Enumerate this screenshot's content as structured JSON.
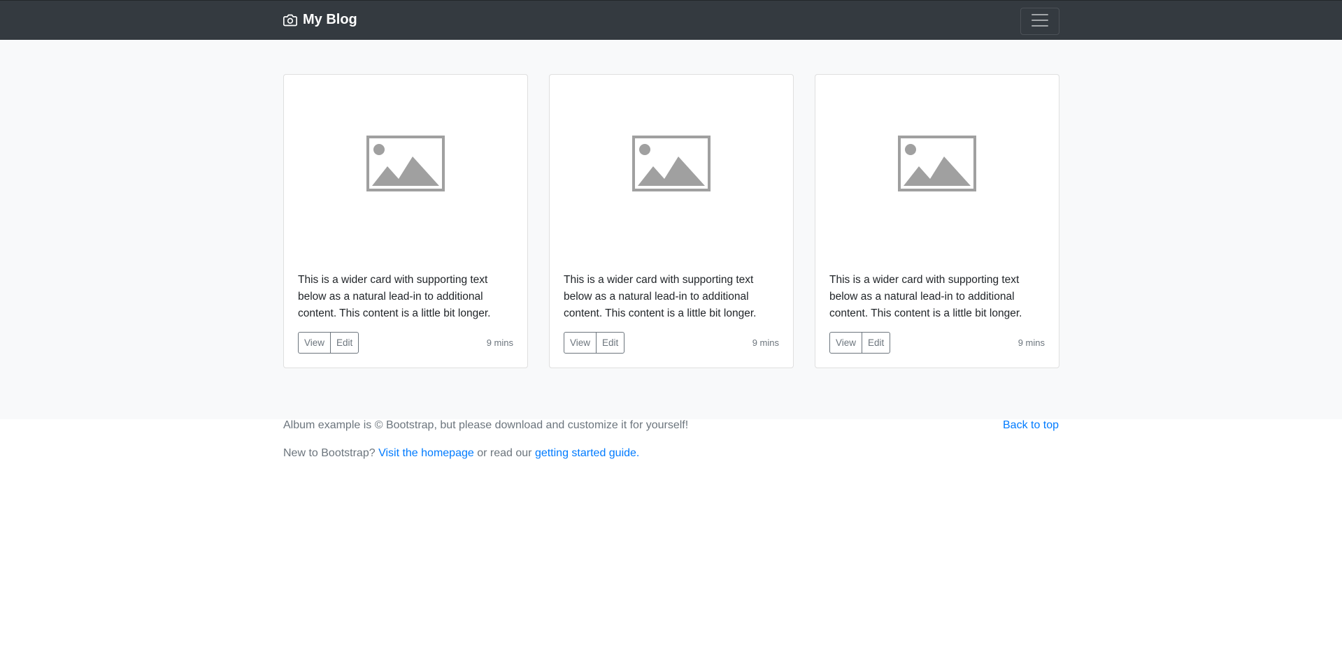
{
  "navbar": {
    "brand": "My Blog",
    "brand_icon": "camera-icon",
    "toggler_icon": "hamburger-menu-icon"
  },
  "cards": [
    {
      "image_icon": "image-placeholder-icon",
      "text": "This is a wider card with supporting text below as a natural lead-in to additional content. This content is a little bit longer.",
      "view_label": "View",
      "edit_label": "Edit",
      "time": "9 mins"
    },
    {
      "image_icon": "image-placeholder-icon",
      "text": "This is a wider card with supporting text below as a natural lead-in to additional content. This content is a little bit longer.",
      "view_label": "View",
      "edit_label": "Edit",
      "time": "9 mins"
    },
    {
      "image_icon": "image-placeholder-icon",
      "text": "This is a wider card with supporting text below as a natural lead-in to additional content. This content is a little bit longer.",
      "view_label": "View",
      "edit_label": "Edit",
      "time": "9 mins"
    }
  ],
  "footer": {
    "copyright": "Album example is © Bootstrap, but please download and customize it for yourself!",
    "back_to_top": "Back to top",
    "new_prefix": "New to Bootstrap?",
    "homepage_link": "Visit the homepage",
    "middle_text": "or read our",
    "guide_link": "getting started guide."
  },
  "colors": {
    "navbar_bg": "#343a40",
    "album_bg": "#f8f9fa",
    "link": "#007bff",
    "muted": "#6c757d"
  }
}
